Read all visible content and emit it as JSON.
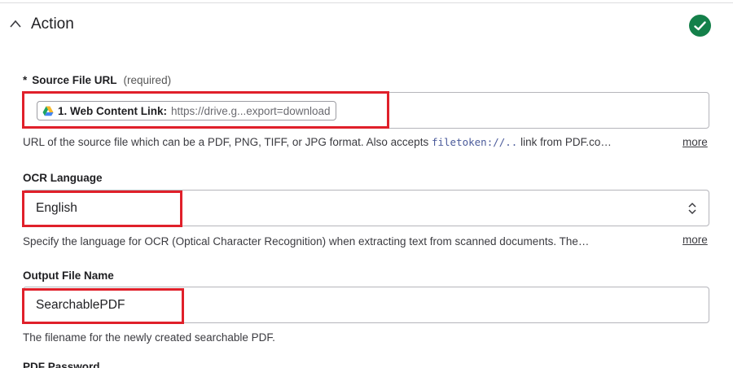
{
  "section": {
    "title": "Action",
    "status_icon": "check-circle-icon",
    "status_color": "#14804a"
  },
  "source_file": {
    "required_marker": "*",
    "label": "Source File URL",
    "required_note": "(required)",
    "pill": {
      "icon": "google-drive-icon",
      "step": "1. Web Content Link:",
      "value": "https://drive.g...export=download"
    },
    "help_prefix": "URL of the source file which can be a PDF, PNG, TIFF, or JPG format. Also accepts",
    "help_code": "filetoken://..",
    "help_suffix": "link from PDF.co…",
    "more": "more"
  },
  "ocr_language": {
    "label": "OCR Language",
    "selected": "English",
    "help": "Specify the language for OCR (Optical Character Recognition) when extracting text from scanned documents. The…",
    "more": "more"
  },
  "output_file": {
    "label": "Output File Name",
    "value": "SearchablePDF",
    "help": "The filename for the newly created searchable PDF."
  },
  "next_field": {
    "label": "PDF Password"
  },
  "highlight_color": "#e0202a"
}
